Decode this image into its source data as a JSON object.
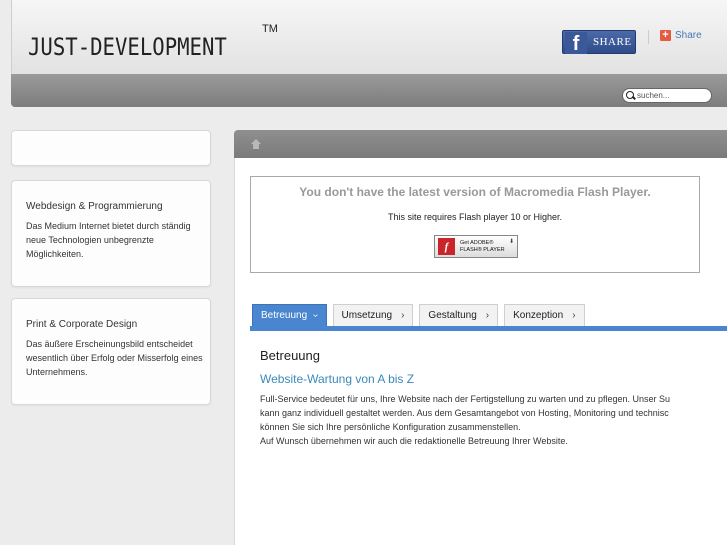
{
  "header": {
    "logo": "JUST-DEVELOPMENT",
    "trademark": "TM",
    "fb_share_label": "SHARE",
    "share_label": "Share"
  },
  "navbar": {
    "search_placeholder": "suchen..."
  },
  "sidebar": {
    "boxes": [
      {
        "title": "Webdesign & Programmierung",
        "text": "Das Medium Internet bietet durch ständig neue Technologien unbegrenzte Möglichkeiten."
      },
      {
        "title": "Print & Corporate Design",
        "text": "Das äußere Erscheinungsbild entscheidet wesentlich über Erfolg oder Misserfolg eines Unternehmens."
      }
    ]
  },
  "flash": {
    "title": "You don't have the latest version of Macromedia Flash Player.",
    "subtitle": "This site requires Flash player 10 or Higher.",
    "badge_line1": "Get ADOBE®",
    "badge_line2": "FLASH® PLAYER"
  },
  "tabs": [
    {
      "label": "Betreuung",
      "active": true
    },
    {
      "label": "Umsetzung",
      "active": false
    },
    {
      "label": "Gestaltung",
      "active": false
    },
    {
      "label": "Konzeption",
      "active": false
    }
  ],
  "content": {
    "title": "Betreuung",
    "link": "Website-Wartung von A bis Z",
    "lines": [
      "Full-Service bedeutet für uns, Ihre Website nach der Fertigstellung zu warten und zu pflegen. Unser Su",
      "kann ganz individuell gestaltet werden. Aus dem Gesamtangebot von Hosting, Monitoring und technisc",
      "können Sie sich Ihre persönliche Konfiguration zusammenstellen.",
      "Auf Wunsch übernehmen wir auch die redaktionelle Betreuung Ihrer Website."
    ]
  },
  "colors": {
    "accent": "#4a86cf",
    "link": "#3a8ab8",
    "facebook": "#3b5998"
  }
}
